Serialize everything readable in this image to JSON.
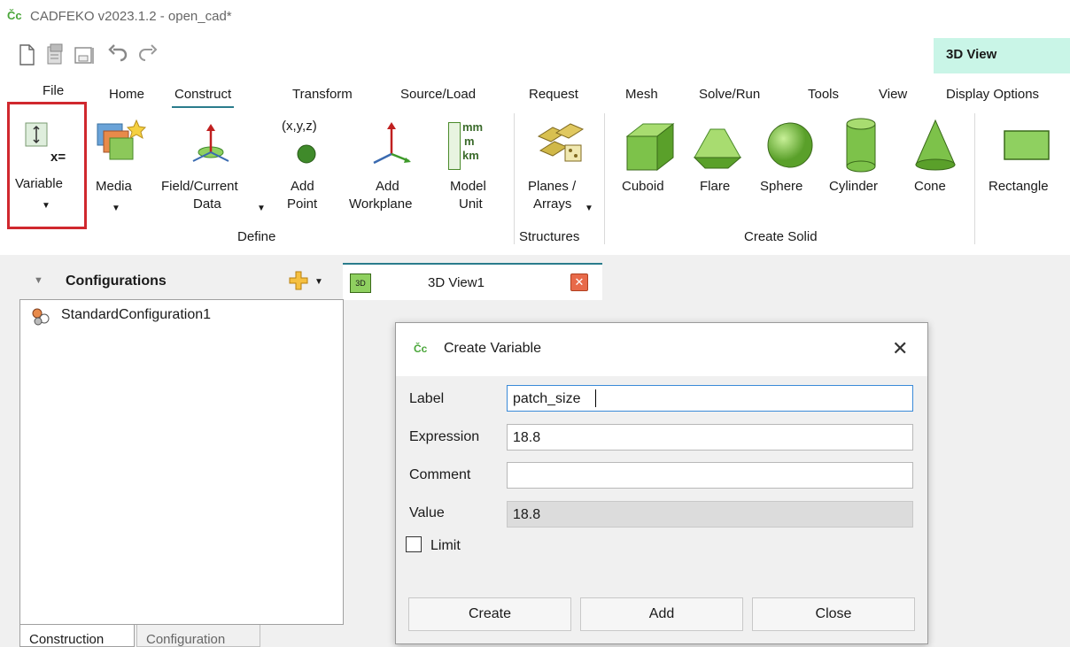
{
  "window": {
    "logo": "Čc",
    "title": "CADFEKO v2023.1.2 - open_cad*"
  },
  "context_tab": "3D View",
  "ribbon_tabs": [
    "File",
    "Home",
    "Construct",
    "Transform",
    "Source/Load",
    "Request",
    "Mesh",
    "Solve/Run",
    "Tools",
    "View",
    "Display Options"
  ],
  "ribbon": {
    "define": {
      "variable": "Variable",
      "media": "Media",
      "field_current": [
        "Field/Current",
        "Data"
      ],
      "add_point": [
        "Add",
        "Point"
      ],
      "add_point_icon_text": "(x,y,z)",
      "add_workplane": [
        "Add",
        "Workplane"
      ],
      "model_unit": [
        "Model",
        "Unit"
      ],
      "model_unit_icon": [
        "mm",
        "m",
        "km"
      ],
      "group": "Define"
    },
    "structures": {
      "planes": [
        "Planes /",
        "Arrays"
      ],
      "group": "Structures"
    },
    "create_solid": {
      "items": [
        "Cuboid",
        "Flare",
        "Sphere",
        "Cylinder",
        "Cone"
      ],
      "group": "Create Solid"
    },
    "rectangle": "Rectangle"
  },
  "configurations": {
    "title": "Configurations",
    "items": [
      "StandardConfiguration1"
    ]
  },
  "bottom_tabs": [
    "Construction",
    "Configuration"
  ],
  "view_tab": {
    "label": "3D View1"
  },
  "dialog": {
    "title": "Create Variable",
    "label_lbl": "Label",
    "label_val": "patch_size",
    "expr_lbl": "Expression",
    "expr_val": "18.8",
    "comment_lbl": "Comment",
    "comment_val": "",
    "value_lbl": "Value",
    "value_val": "18.8",
    "limit_lbl": "Limit",
    "limit_checked": false,
    "buttons": {
      "create": "Create",
      "add": "Add",
      "close": "Close"
    }
  },
  "colors": {
    "highlight": "#d0282e",
    "accent_tab": "#2a7c8c",
    "context_tab_bg": "#c9f5e7",
    "solid_green": "#7dc24a"
  }
}
